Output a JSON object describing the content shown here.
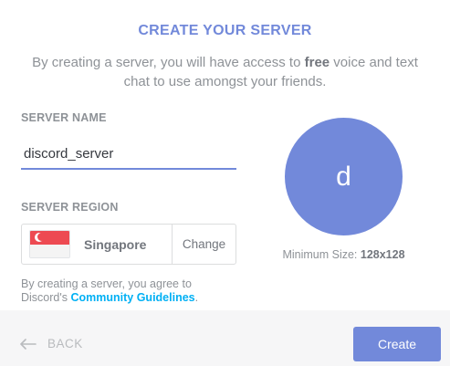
{
  "header": {
    "title": "CREATE YOUR SERVER",
    "subtitle_pre": "By creating a server, you will have access to ",
    "subtitle_bold": "free",
    "subtitle_post": " voice and text chat to use amongst your friends."
  },
  "form": {
    "server_name_label": "SERVER NAME",
    "server_name_value": "discord_server",
    "server_region_label": "SERVER REGION",
    "region_name": "Singapore",
    "region_flag_icon": "singapore-flag-icon",
    "change_label": "Change"
  },
  "agreement": {
    "text": "By creating a server, you agree to Discord's ",
    "link": "Community Guidelines",
    "end": "."
  },
  "avatar": {
    "letter": "d",
    "min_size_label": "Minimum Size: ",
    "min_size_value": "128x128",
    "color": "#7289da"
  },
  "footer": {
    "back_label": "BACK",
    "back_icon": "arrow-left-icon",
    "create_label": "Create"
  },
  "colors": {
    "accent": "#7289da",
    "link": "#00b0f4"
  }
}
